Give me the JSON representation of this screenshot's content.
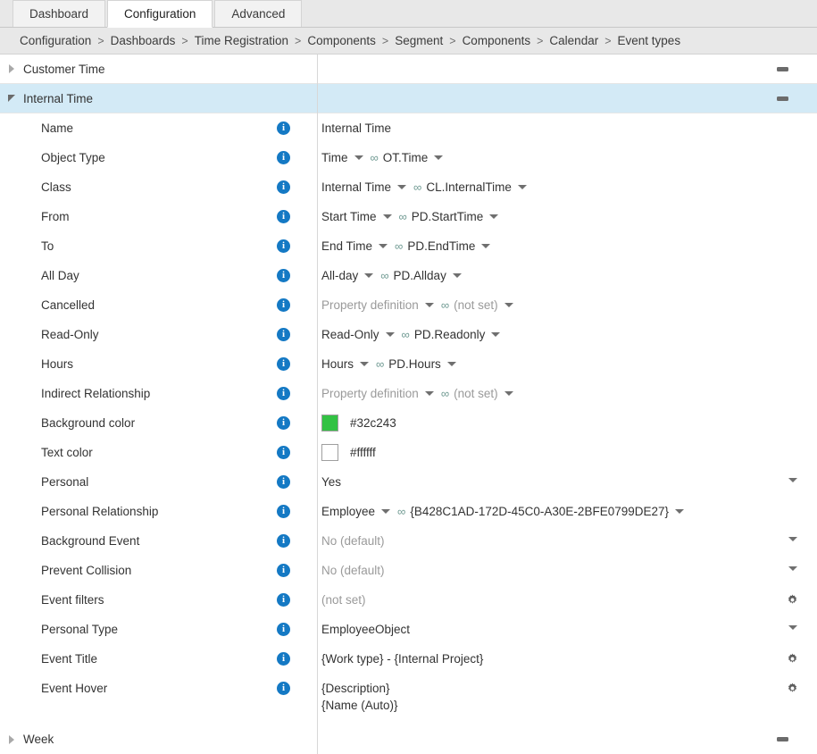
{
  "tabs": [
    {
      "label": "Dashboard",
      "active": false
    },
    {
      "label": "Configuration",
      "active": true
    },
    {
      "label": "Advanced",
      "active": false
    }
  ],
  "breadcrumb": [
    "Configuration",
    "Dashboards",
    "Time Registration",
    "Components",
    "Segment",
    "Components",
    "Calendar",
    "Event types"
  ],
  "breadcrumb_separator": ">",
  "icons": {
    "info": "i",
    "link": "∞",
    "minus": "minus-icon",
    "gear": "gear-icon",
    "caret": "chevron-down-icon"
  },
  "colors": {
    "selection": "#d3eaf6",
    "info_badge": "#1479c4",
    "link_icon": "#6f9a92",
    "background_color_swatch": "#32c243",
    "text_color_swatch": "#ffffff"
  },
  "groups": {
    "customer_time": {
      "label": "Customer Time",
      "expanded": false
    },
    "internal_time": {
      "label": "Internal Time",
      "expanded": true,
      "selected": true
    },
    "week": {
      "label": "Week",
      "expanded": false
    }
  },
  "rows": [
    {
      "label": "Name",
      "type": "text",
      "value": "Internal Time"
    },
    {
      "label": "Object Type",
      "type": "linked",
      "value": "Time",
      "linked_value": "OT.Time"
    },
    {
      "label": "Class",
      "type": "linked",
      "value": "Internal Time",
      "linked_value": "CL.InternalTime"
    },
    {
      "label": "From",
      "type": "linked",
      "value": "Start Time",
      "linked_value": "PD.StartTime"
    },
    {
      "label": "To",
      "type": "linked",
      "value": "End Time",
      "linked_value": "PD.EndTime"
    },
    {
      "label": "All Day",
      "type": "linked",
      "value": "All-day",
      "linked_value": "PD.Allday"
    },
    {
      "label": "Cancelled",
      "type": "linked",
      "value": "Property definition",
      "linked_value": "(not set)",
      "muted": true,
      "linked_muted": true
    },
    {
      "label": "Read-Only",
      "type": "linked",
      "value": "Read-Only",
      "linked_value": "PD.Readonly"
    },
    {
      "label": "Hours",
      "type": "linked",
      "value": "Hours",
      "linked_value": "PD.Hours"
    },
    {
      "label": "Indirect Relationship",
      "type": "linked",
      "value": "Property definition",
      "linked_value": "(not set)",
      "muted": true,
      "linked_muted": true
    },
    {
      "label": "Background color",
      "type": "color",
      "value": "#32c243",
      "swatch": "#32c243"
    },
    {
      "label": "Text color",
      "type": "color",
      "value": "#ffffff",
      "swatch": "#ffffff"
    },
    {
      "label": "Personal",
      "type": "select",
      "value": "Yes",
      "end": "caret"
    },
    {
      "label": "Personal Relationship",
      "type": "linked",
      "value": "Employee",
      "linked_value": "{B428C1AD-172D-45C0-A30E-2BFE0799DE27}"
    },
    {
      "label": "Background Event",
      "type": "select",
      "value": "No (default)",
      "muted": true,
      "end": "caret"
    },
    {
      "label": "Prevent Collision",
      "type": "select",
      "value": "No (default)",
      "muted": true,
      "end": "caret"
    },
    {
      "label": "Event filters",
      "type": "text",
      "value": "(not set)",
      "muted": true,
      "end": "gear"
    },
    {
      "label": "Personal Type",
      "type": "select",
      "value": "EmployeeObject",
      "end": "caret"
    },
    {
      "label": "Event Title",
      "type": "text",
      "value": "{Work type} - {Internal Project}",
      "end": "gear"
    },
    {
      "label": "Event Hover",
      "type": "text",
      "value": "{Description}\n{Name (Auto)}",
      "multiline": true,
      "end": "gear"
    }
  ]
}
